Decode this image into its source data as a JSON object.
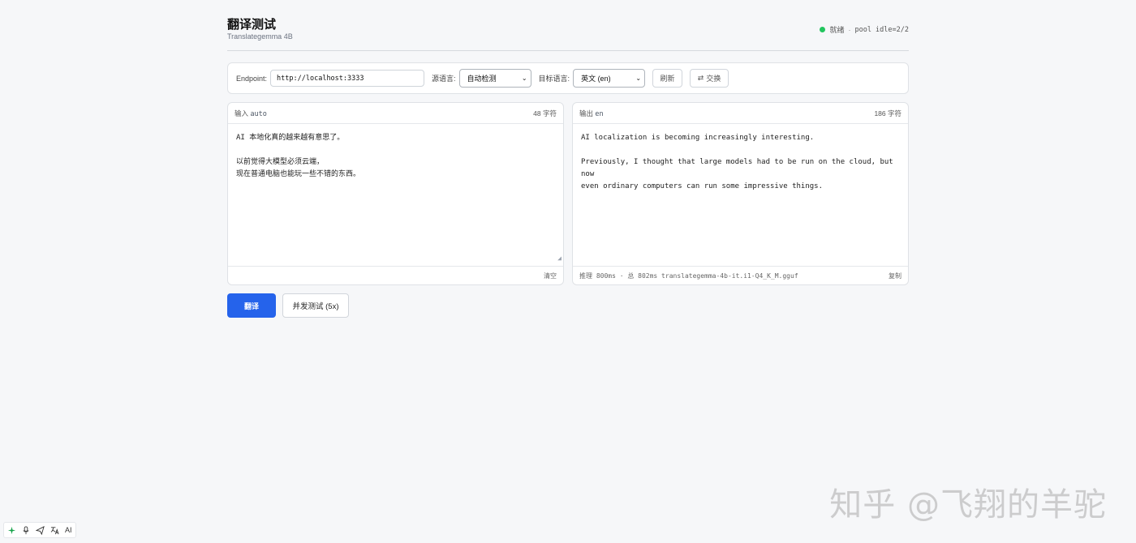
{
  "header": {
    "title": "翻译测试",
    "subtitle": "Translategemma 4B",
    "status_text": "就绪",
    "separator": "·",
    "pool_text": "pool idle=2/2",
    "status_color": "#22c55e"
  },
  "toolbar": {
    "endpoint_label": "Endpoint:",
    "endpoint_value": "http://localhost:3333",
    "source_label": "源语言:",
    "source_value": "自动检测",
    "target_label": "目标语言:",
    "target_value": "英文 (en)",
    "refresh_label": "刷新",
    "swap_label": "交换",
    "swap_icon": "⇄"
  },
  "input_panel": {
    "header_label": "输入",
    "header_tag": "auto",
    "char_count": "48 字符",
    "text": "AI 本地化真的越来越有意思了。\n\n以前觉得大模型必须云端，\n现在普通电脑也能玩一些不错的东西。",
    "clear_label": "清空"
  },
  "output_panel": {
    "header_label": "输出",
    "header_tag": "en",
    "char_count": "186 字符",
    "text": "AI localization is becoming increasingly interesting.\n\nPreviously, I thought that large models had to be run on the cloud, but now\neven ordinary computers can run some impressive things.",
    "footer_info": "推理 800ms · 总 802ms   translategemma-4b-it.i1-Q4_K_M.gguf",
    "copy_label": "复制"
  },
  "actions": {
    "translate_label": "翻译",
    "concurrent_label": "并发测试 (5x)",
    "primary_color": "#2563eb"
  },
  "watermark": "知乎 @飞翔的羊驼",
  "bottombar": {
    "icons": [
      "sparkle-icon",
      "mic-icon",
      "send-icon",
      "translate-icon"
    ],
    "ai_label": "AI"
  }
}
